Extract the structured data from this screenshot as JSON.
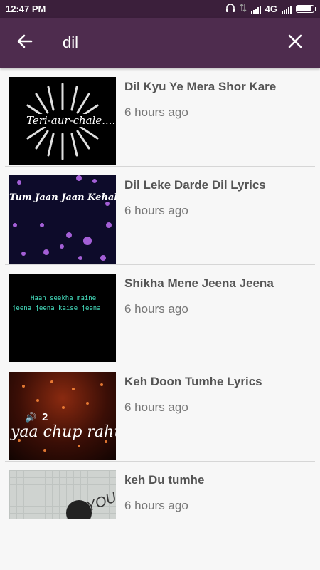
{
  "status_bar": {
    "time": "12:47 PM",
    "network": "4G",
    "icons": [
      "headphones-icon",
      "data-transfer-icon",
      "signal-icon",
      "battery-icon"
    ],
    "battery_level": 0.95
  },
  "search": {
    "query": "dil",
    "back_icon": "arrow-left-icon",
    "clear_icon": "close-icon"
  },
  "colors": {
    "status_bar": "#3b1f3b",
    "app_bar": "#4e2c4e",
    "background": "#f7f7f7"
  },
  "results": [
    {
      "title": "Dil Kyu Ye Mera Shor Kare",
      "time": "6 hours ago",
      "thumb_text": "Teri-aur-chale...."
    },
    {
      "title": "Dil Leke Darde Dil Lyrics",
      "time": "6 hours ago",
      "thumb_text": "Tum Jaan Jaan Kehake"
    },
    {
      "title": "Shikha Mene Jeena Jeena",
      "time": "6 hours ago",
      "thumb_text": "Haan seekha maine",
      "thumb_text2": "jeena jeena kaise jeena"
    },
    {
      "title": "Keh Doon Tumhe Lyrics",
      "time": "6 hours ago",
      "thumb_text": "yaa chup rahu",
      "thumb_text2": "2"
    },
    {
      "title": "keh Du tumhe",
      "time": "6 hours ago",
      "thumb_text": "YOU"
    }
  ]
}
